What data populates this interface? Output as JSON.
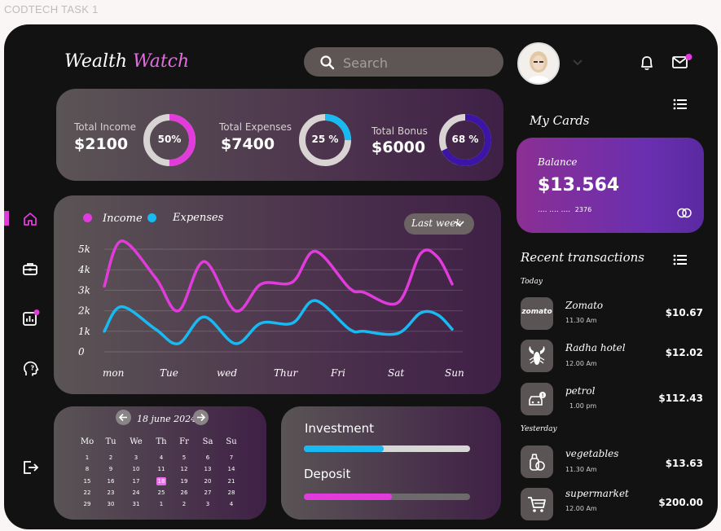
{
  "frame_label": "CODTECH TASK 1",
  "brand": {
    "part1": "Wealth ",
    "part2": "Watch"
  },
  "search": {
    "placeholder": "Search"
  },
  "colors": {
    "accent": "#e23bdc",
    "expenses": "#19b9f1",
    "card": "#6a2fb0",
    "bonus": "#3d15a6"
  },
  "sidebar": {
    "items": [
      {
        "icon": "home-icon",
        "active": true
      },
      {
        "icon": "briefcase-icon",
        "active": false
      },
      {
        "icon": "report-chart-icon",
        "active": false,
        "badge": true
      },
      {
        "icon": "help-head-icon",
        "active": false
      },
      {
        "icon": "logout-icon",
        "active": false
      }
    ]
  },
  "header": {
    "icons": [
      "chevron-down-icon",
      "bell-icon",
      "mail-icon"
    ],
    "mail_badge": true
  },
  "stats": [
    {
      "label": "Total Income",
      "value": "$2100",
      "percent": 50,
      "percent_label": "50%",
      "color": "#e23bdc"
    },
    {
      "label": "Total Expenses",
      "value": "$7400",
      "percent": 25,
      "percent_label": "25 %",
      "color": "#19b9f1"
    },
    {
      "label": "Total Bonus",
      "value": "$6000",
      "percent": 68,
      "percent_label": "68 %",
      "color": "#3d15a6"
    }
  ],
  "chart_data": {
    "type": "line",
    "legend": [
      "Income",
      "Expenses"
    ],
    "filter": "Last week",
    "categories": [
      "mon",
      "Tue",
      "wed",
      "Thur",
      "Fri",
      "Sat",
      "Sun"
    ],
    "y_ticks": [
      "5k",
      "4k",
      "3k",
      "2k",
      "1k",
      "0"
    ],
    "ylim": [
      0,
      5000
    ],
    "grid": true,
    "series": [
      {
        "name": "Income",
        "color": "#e23bdc",
        "x": [
          0,
          0.3,
          0.9,
          1.3,
          1.75,
          2.3,
          2.75,
          3.3,
          3.7,
          4.3,
          4.55,
          5.15,
          5.55,
          5.85,
          6.1
        ],
        "values": [
          3200,
          5400,
          3600,
          2000,
          4400,
          2000,
          3300,
          3400,
          4900,
          3100,
          2900,
          2400,
          4800,
          4600,
          3300
        ]
      },
      {
        "name": "Expenses",
        "color": "#19b9f1",
        "x": [
          0,
          0.3,
          0.9,
          1.3,
          1.75,
          2.3,
          2.75,
          3.3,
          3.7,
          4.3,
          4.55,
          5.15,
          5.55,
          5.85,
          6.1
        ],
        "values": [
          1000,
          2200,
          1100,
          400,
          1700,
          400,
          1400,
          1400,
          2500,
          1100,
          1000,
          900,
          1900,
          1800,
          1100
        ]
      }
    ]
  },
  "calendar": {
    "title": "18 june 2024",
    "weekdays": [
      "Mo",
      "Tu",
      "We",
      "Th",
      "Fr",
      "Sa",
      "Su"
    ],
    "weeks": [
      [
        "1",
        "2",
        "3",
        "4",
        "5",
        "6",
        "7"
      ],
      [
        "8",
        "9",
        "10",
        "11",
        "12",
        "13",
        "14"
      ],
      [
        "15",
        "16",
        "17",
        "18",
        "19",
        "20",
        "21"
      ],
      [
        "22",
        "23",
        "24",
        "25",
        "26",
        "27",
        "28"
      ],
      [
        "29",
        "30",
        "31",
        "1",
        "2",
        "3",
        "4"
      ]
    ],
    "selected": "18"
  },
  "progress": [
    {
      "label": "Investment",
      "value": 0.48,
      "fill": "#19b9f1",
      "track": "#d9d6d6"
    },
    {
      "label": "Deposit",
      "value": 0.53,
      "fill": "#e23bdc",
      "track": "#6c6a6a"
    }
  ],
  "my_cards": {
    "title": "My Cards",
    "balance_label": "Balance",
    "balance": "$13.564",
    "masked": "....  ....  ....",
    "last4": "2376"
  },
  "transactions": {
    "title": "Recent transactions",
    "groups": [
      {
        "label": "Today",
        "items": [
          {
            "name": "Zomato",
            "time": "11.30 Am",
            "amount": "$10.67",
            "icon": "zomato-logo-icon",
            "logo_text": "zomato"
          },
          {
            "name": "Radha hotel",
            "time": "12.00 Am",
            "amount": "$12.02",
            "icon": "hotel-lobster-icon"
          },
          {
            "name": "petrol",
            "time": "1.00  pm",
            "amount": "$112.43",
            "icon": "car-fuel-icon"
          }
        ]
      },
      {
        "label": "Yesterday",
        "items": [
          {
            "name": "vegetables",
            "time": "11.30 Am",
            "amount": "$13.63",
            "icon": "vegetables-icon"
          },
          {
            "name": "supermarket",
            "time": "12.00  Am",
            "amount": "$200.00",
            "icon": "shopping-cart-icon"
          }
        ]
      }
    ]
  }
}
